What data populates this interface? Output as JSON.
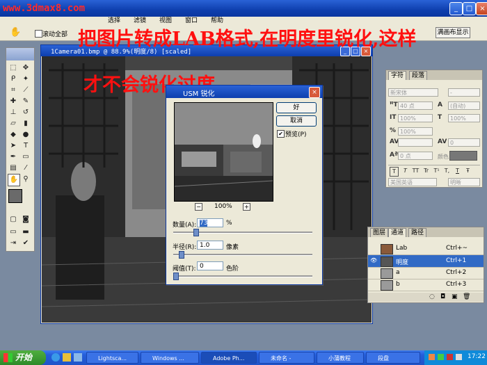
{
  "app": {
    "site_watermark": "www.3dmax8.com",
    "window_controls": [
      "_",
      "□",
      "×"
    ],
    "menu": [
      "选择",
      "滤镜",
      "视图",
      "窗口",
      "帮助"
    ]
  },
  "options_bar": {
    "scroll_all_label": "滚动全部",
    "fit_screen_label": "满画布显示"
  },
  "annotation": {
    "line1": "把图片转成LAB格式,在明度里锐化,这样",
    "line2": "才不会锐化过度",
    "color": "#ff1010"
  },
  "document": {
    "title": "1Camera01.bmp @ 88.9%(明度/8) [scaled]"
  },
  "usm_dialog": {
    "title": "USM 锐化",
    "ok": "好",
    "cancel": "取消",
    "preview_label": "预览(P)",
    "preview_checked": true,
    "zoom": "100%",
    "amount_label": "数量(A):",
    "amount_value": "73",
    "amount_unit": "%",
    "amount_level": 0.15,
    "radius_label": "半径(R):",
    "radius_value": "1.0",
    "radius_unit": "像素",
    "radius_level": 0.04,
    "threshold_label": "阈值(T):",
    "threshold_value": "0",
    "threshold_unit": "色阶",
    "threshold_level": 0.0
  },
  "char_panel": {
    "tabs": [
      "字符",
      "段落"
    ],
    "font_family": "新宋体",
    "font_style": "-",
    "size": "40 点",
    "leading": "(自动)",
    "vscale": "100%",
    "hscale": "100%",
    "tracking_scale": "100%",
    "kerning": "0",
    "baseline": "0 点",
    "color_label": "颜色:",
    "styles": [
      "T",
      "T",
      "TT",
      "Tr",
      "T¹",
      "T,",
      "T",
      "Ŧ"
    ],
    "language": "美国英语",
    "antialias": "明晰"
  },
  "channels_panel": {
    "tabs": [
      "图层",
      "通道",
      "路径"
    ],
    "rows": [
      {
        "name": "Lab",
        "shortcut": "Ctrl+~",
        "selected": false
      },
      {
        "name": "明度",
        "shortcut": "Ctrl+1",
        "selected": true
      },
      {
        "name": "a",
        "shortcut": "Ctrl+2",
        "selected": false
      },
      {
        "name": "b",
        "shortcut": "Ctrl+3",
        "selected": false
      }
    ]
  },
  "taskbar": {
    "start": "开始",
    "tasks": [
      "Lightsca...",
      "Windows ...",
      "Adobe Ph...",
      "未命名 -",
      "小蒲教程",
      "段盘"
    ],
    "clock": "17:22"
  }
}
